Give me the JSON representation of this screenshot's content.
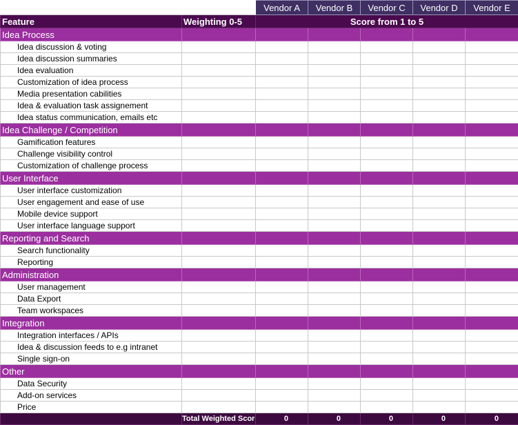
{
  "header": {
    "vendors": [
      "Vendor A",
      "Vendor B",
      "Vendor C",
      "Vendor D",
      "Vendor E"
    ],
    "feature_label": "Feature",
    "weighting_label": "Weighting 0-5",
    "score_label": "Score from 1 to 5"
  },
  "sections": [
    {
      "title": "Idea Process",
      "items": [
        "Idea discussion & voting",
        "Idea discussion summaries",
        "Idea evaluation",
        "Customization of idea process",
        "Media presentation cabilities",
        "Idea & evaluation task assignement",
        "Idea status communication, emails etc"
      ]
    },
    {
      "title": "Idea Challenge / Competition",
      "items": [
        "Gamification features",
        "Challenge visibility control",
        "Customization of challenge process"
      ]
    },
    {
      "title": "User Interface",
      "items": [
        "User interface customization",
        "User engagement and ease of use",
        "Mobile device support",
        "User interface language support"
      ]
    },
    {
      "title": "Reporting and Search",
      "items": [
        "Search functionality",
        "Reporting"
      ]
    },
    {
      "title": "Administration",
      "items": [
        "User management",
        "Data Export",
        "Team workspaces"
      ]
    },
    {
      "title": "Integration",
      "items": [
        "Integration interfaces / APIs",
        "Idea & discussion feeds to e.g intranet",
        "Single sign-on"
      ]
    },
    {
      "title": "Other",
      "items": [
        "Data Security",
        "Add-on services",
        "Price"
      ]
    }
  ],
  "footer": {
    "total_label": "Total Weighted Score",
    "totals": [
      "0",
      "0",
      "0",
      "0",
      "0"
    ]
  }
}
